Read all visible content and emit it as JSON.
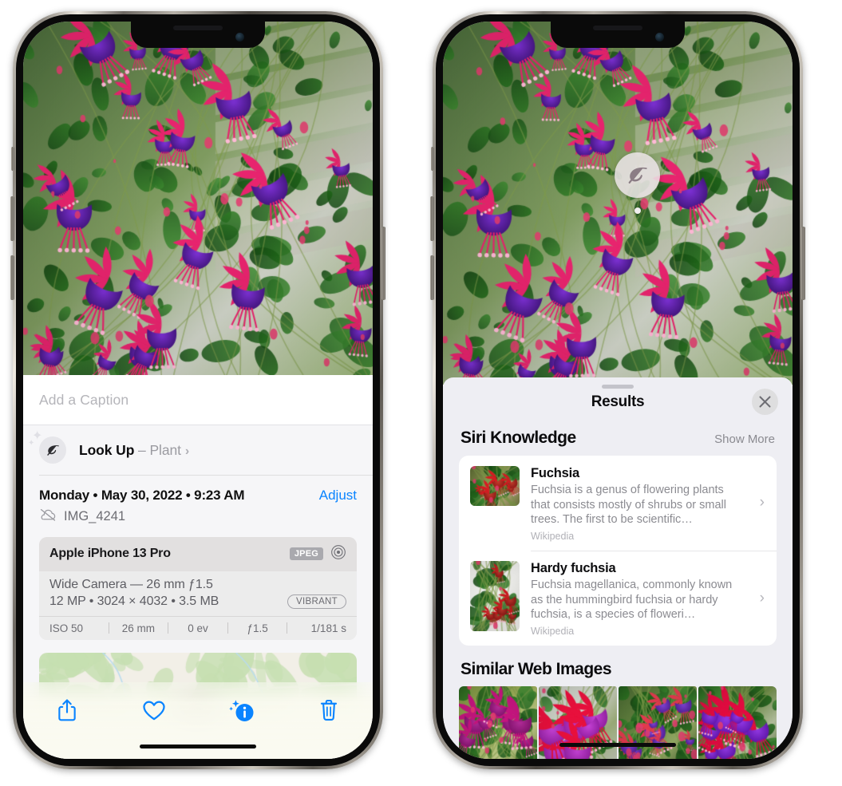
{
  "left_phone": {
    "caption_field": {
      "placeholder": "Add a Caption",
      "value": ""
    },
    "look_up_row": {
      "icon": "leaf-icon",
      "sparkle": "✦",
      "label": "Look Up",
      "separator": " – ",
      "subject": "Plant",
      "chevron": "›"
    },
    "date_row": {
      "date_text": "Monday • May 30, 2022 • 9:23 AM",
      "adjust_label": "Adjust"
    },
    "file_row": {
      "icon": "cloud-slash-icon",
      "file_name": "IMG_4241"
    },
    "metadata_card": {
      "device": "Apple iPhone 13 Pro",
      "format_badge": "JPEG",
      "aperture_icon": "aperture-icon",
      "lens_line": "Wide Camera — 26 mm ƒ1.5",
      "size_line": "12 MP • 3024 × 4032 • 3.5 MB",
      "style_pill": "VIBRANT",
      "exif": [
        "ISO 50",
        "26 mm",
        "0 ev",
        "ƒ1.5",
        "1/181 s"
      ]
    },
    "toolbar": {
      "share_label": "share-icon",
      "favorite_label": "heart-icon",
      "info_label": "info-sparkle-icon",
      "delete_label": "trash-icon"
    }
  },
  "right_phone": {
    "visual_lookup_badge": {
      "icon": "leaf-icon"
    },
    "sheet": {
      "title": "Results",
      "close_label": "✕",
      "sections": [
        {
          "title": "Siri Knowledge",
          "action": "Show More",
          "items": [
            {
              "title": "Fuchsia",
              "description": "Fuchsia is a genus of flowering plants that consists mostly of shrubs or small trees. The first to be scientific…",
              "source": "Wikipedia",
              "chevron": "›"
            },
            {
              "title": "Hardy fuchsia",
              "description": "Fuchsia magellanica, commonly known as the hummingbird fuchsia or hardy fuchsia, is a species of floweri…",
              "source": "Wikipedia",
              "chevron": "›"
            }
          ]
        },
        {
          "title": "Similar Web Images",
          "action": "",
          "thumbnails": [
            "web-image-1",
            "web-image-2",
            "web-image-3",
            "web-image-4"
          ]
        }
      ]
    }
  },
  "colors": {
    "accent_blue": "#0a84ff",
    "sheet_bg": "#eeeef3",
    "panel_bg": "#f6f6f8",
    "card_bg": "#ececec",
    "secondary_text": "#8b8b91"
  }
}
